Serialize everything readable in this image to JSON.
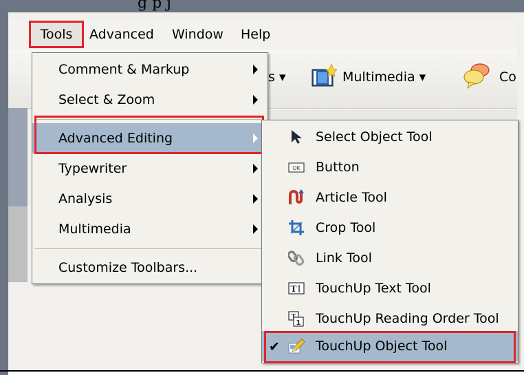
{
  "partial_title": "g        p     j",
  "menubar": {
    "items": [
      "Tools",
      "Advanced",
      "Window",
      "Help"
    ]
  },
  "toolbar": {
    "partial_left": "s ▾",
    "multimedia_label": "Multimedia ▾",
    "partial_right": "Co"
  },
  "tools_menu": {
    "items": [
      {
        "label": "Comment & Markup",
        "has_submenu": true
      },
      {
        "label": "Select & Zoom",
        "has_submenu": true
      },
      {
        "label": "Advanced Editing",
        "has_submenu": true,
        "highlighted": true
      },
      {
        "label": "Typewriter",
        "has_submenu": true
      },
      {
        "label": "Analysis",
        "has_submenu": true
      },
      {
        "label": "Multimedia",
        "has_submenu": true
      },
      {
        "label": "Customize Toolbars...",
        "has_submenu": false
      }
    ]
  },
  "advanced_editing_submenu": {
    "items": [
      {
        "label": "Select Object Tool",
        "icon": "arrow-pointer-icon"
      },
      {
        "label": "Button",
        "icon": "ok-button-icon"
      },
      {
        "label": "Article Tool",
        "icon": "article-icon"
      },
      {
        "label": "Crop Tool",
        "icon": "crop-icon"
      },
      {
        "label": "Link Tool",
        "icon": "link-icon"
      },
      {
        "label": "TouchUp Text Tool",
        "icon": "text-cursor-icon"
      },
      {
        "label": "TouchUp Reading Order Tool",
        "icon": "reading-order-icon"
      },
      {
        "label": "TouchUp Object Tool",
        "icon": "pencil-icon",
        "checked": true,
        "highlighted": true
      }
    ]
  },
  "colors": {
    "highlight": "#a5b8cc",
    "outline": "#e0242c",
    "frame": "#6b7584"
  }
}
